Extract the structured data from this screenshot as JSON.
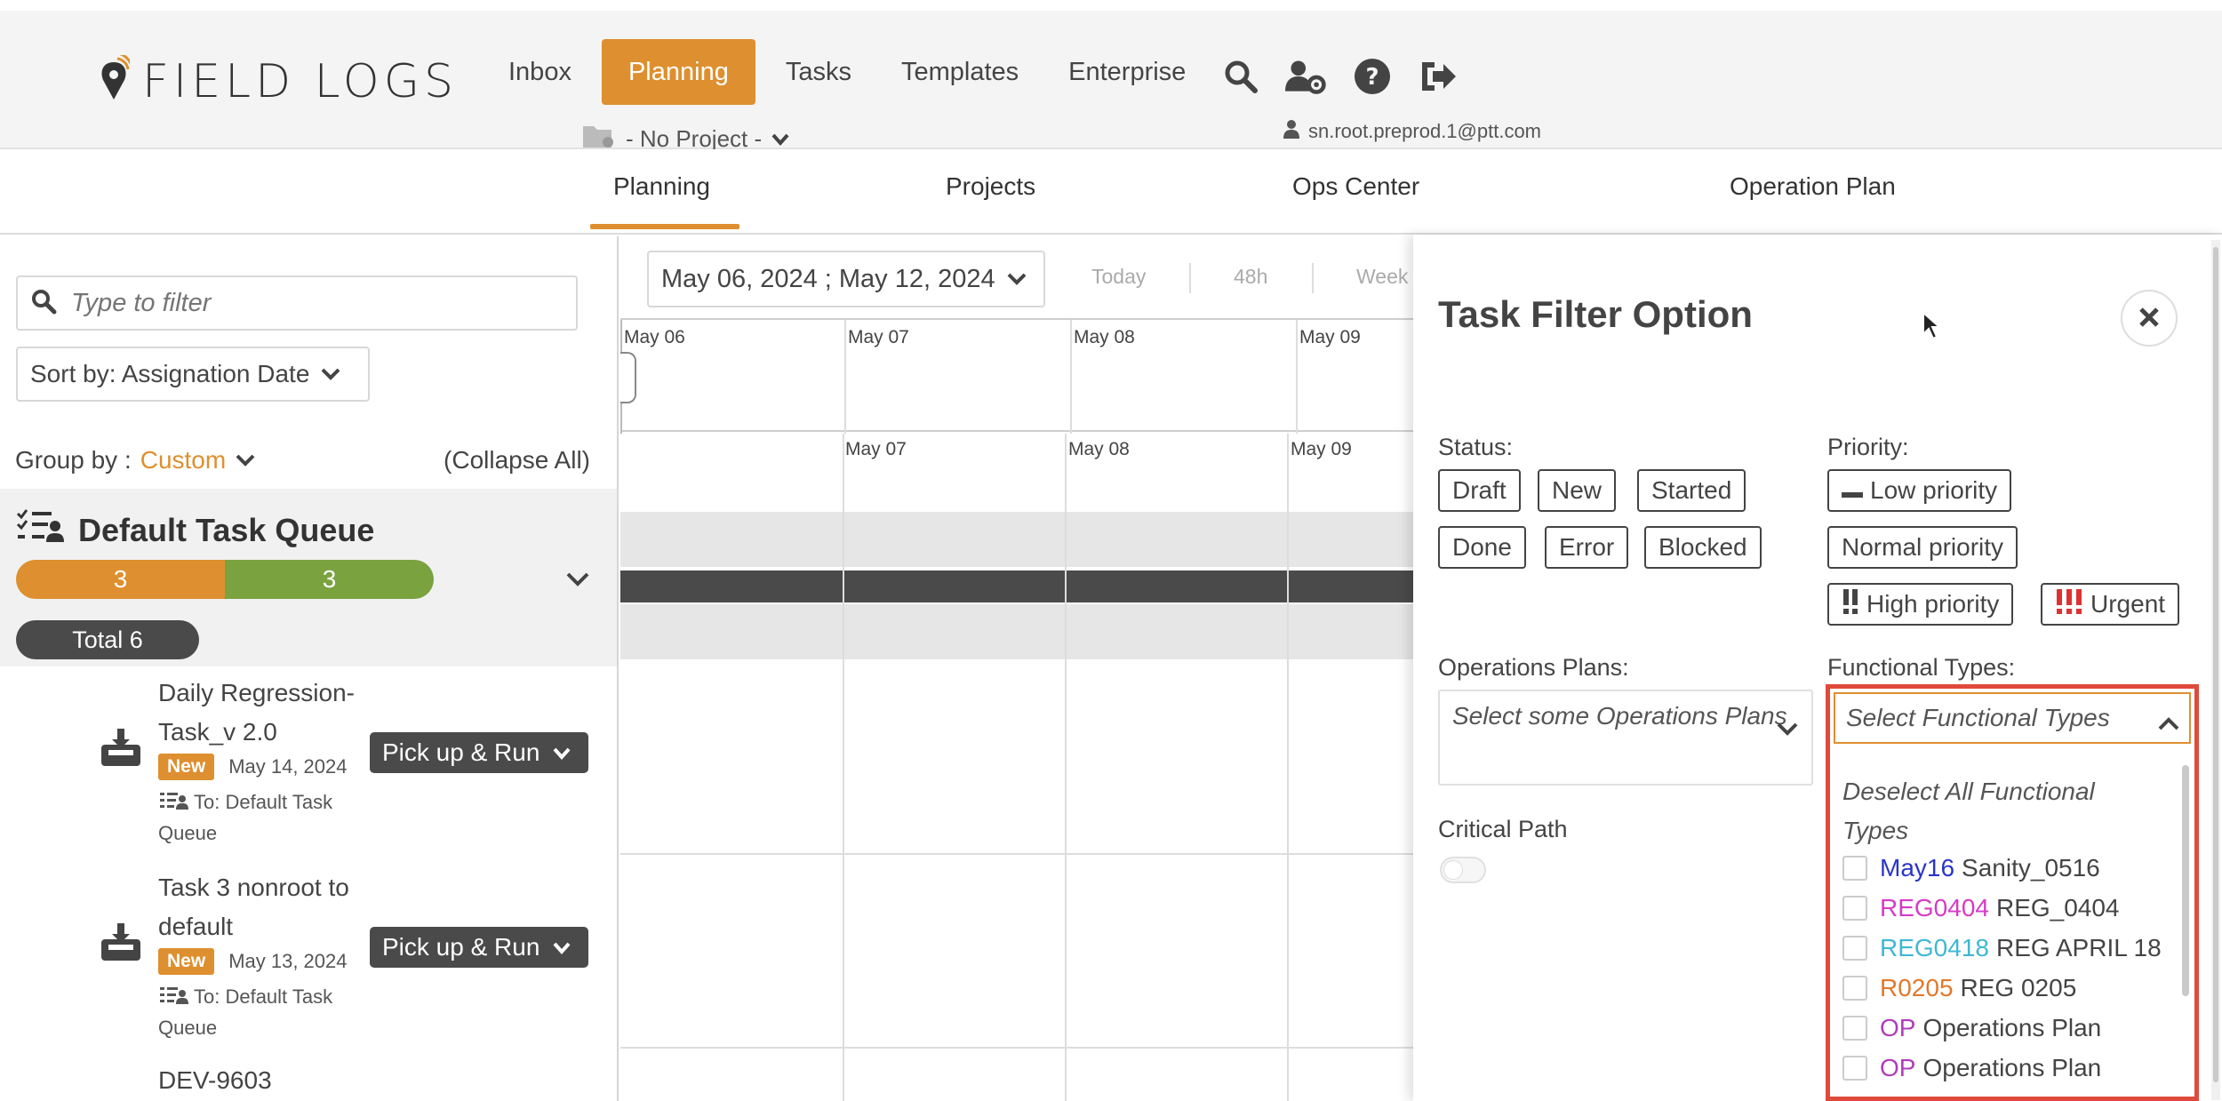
{
  "header": {
    "logo_text": "FIELD LOGS",
    "nav": [
      {
        "label": "Inbox",
        "active": false
      },
      {
        "label": "Planning",
        "active": true
      },
      {
        "label": "Tasks",
        "active": false
      },
      {
        "label": "Templates",
        "active": false
      },
      {
        "label": "Enterprise",
        "active": false
      }
    ],
    "icons": [
      "search-icon",
      "user-settings-icon",
      "help-icon",
      "logout-icon"
    ],
    "project_selector": "- No Project -",
    "user_email": "sn.root.preprod.1@ptt.com"
  },
  "subnav": {
    "items": [
      "Planning",
      "Projects",
      "Ops Center",
      "Operation Plan"
    ],
    "active": "Planning"
  },
  "left": {
    "filter_placeholder": "Type to filter",
    "sort_label": "Sort by: Assignation Date",
    "group_by_label": "Group by :",
    "group_by_value": "Custom",
    "collapse_all": "(Collapse All)",
    "queue": {
      "title": "Default Task Queue",
      "segments": [
        {
          "value": "3",
          "color": "#de8f2f"
        },
        {
          "value": "3",
          "color": "#7aa23f"
        }
      ],
      "total": "Total 6"
    },
    "tasks": [
      {
        "name": "Daily Regression-Task_v 2.0",
        "badge": "New",
        "date": "May 14, 2024",
        "to": "To: Default Task Queue",
        "action": "Pick up & Run"
      },
      {
        "name": "Task 3 nonroot to default",
        "badge": "New",
        "date": "May 13, 2024",
        "to": "To: Default Task Queue",
        "action": "Pick up & Run"
      },
      {
        "name": "DEV-9603"
      }
    ]
  },
  "calendar": {
    "range": "May 06, 2024 ; May 12, 2024",
    "quick": [
      "Today",
      "48h",
      "Week"
    ],
    "header_days": [
      "May 06",
      "May 07",
      "May 08",
      "May 09"
    ],
    "row_days": [
      "May 07",
      "May 08",
      "May 09"
    ]
  },
  "filter_panel": {
    "title": "Task Filter Option",
    "status_label": "Status:",
    "statuses": [
      "Draft",
      "New",
      "Started",
      "Done",
      "Error",
      "Blocked"
    ],
    "priority_label": "Priority:",
    "priorities": [
      "Low priority",
      "Normal priority",
      "High priority",
      "Urgent"
    ],
    "ops_plans_label": "Operations Plans:",
    "ops_plans_placeholder": "Select some Operations Plans",
    "critical_path_label": "Critical Path",
    "critical_path_on": false,
    "functional_types_label": "Functional Types:",
    "functional_types_placeholder": "Select Functional Types",
    "deselect_all": "Deselect All Functional Types",
    "functional_types": [
      {
        "code": "May16",
        "name": "Sanity_0516",
        "color": "#2a35c9"
      },
      {
        "code": "REG0404",
        "name": "REG_0404",
        "color": "#d63bc6"
      },
      {
        "code": "REG0418",
        "name": "REG APRIL 18",
        "color": "#3fb7d3"
      },
      {
        "code": "R0205",
        "name": "REG 0205",
        "color": "#e0792b"
      },
      {
        "code": "OP",
        "name": "Operations Plan",
        "color": "#b03cb8"
      },
      {
        "code": "OP",
        "name": "Operations Plan",
        "color": "#b03cb8"
      }
    ]
  },
  "colors": {
    "accent": "#de8f2f",
    "dark": "#4a4a4a",
    "highlight": "#e04a3a",
    "urgent": "#e03131"
  }
}
